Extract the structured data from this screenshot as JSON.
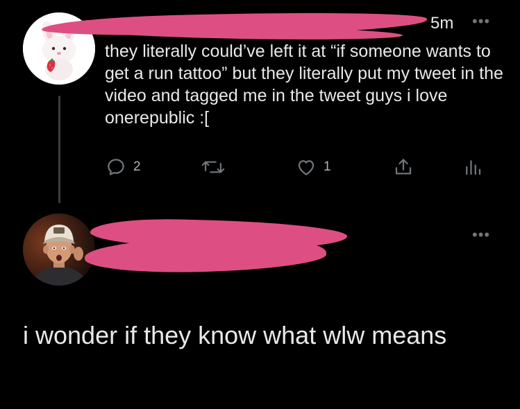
{
  "tweet1": {
    "timestamp": "5m",
    "more_icon": "more-horizontal-icon",
    "avatar_icon": "strawberry-bunny-plush-avatar",
    "text": "they literally could’ve left it at “if someone wants to get a run tattoo” but they literally put my tweet in the video and tagged me in the tweet guys i love onerepublic :[",
    "actions": {
      "reply_count": "2",
      "like_count": "1"
    }
  },
  "tweet2": {
    "avatar_icon": "man-in-cap-avatar",
    "more_icon": "more-horizontal-icon",
    "text": "i wonder if they know what wlw means"
  },
  "colors": {
    "background": "#000000",
    "text": "#e7e9ea",
    "muted": "#71767b",
    "redaction": "#dd4f82"
  }
}
